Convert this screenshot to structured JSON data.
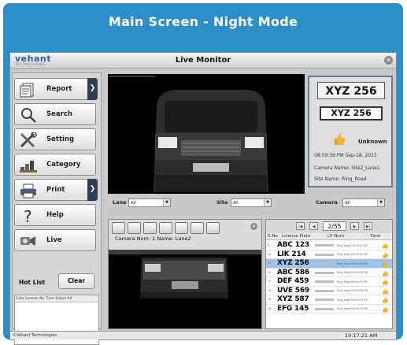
{
  "banner": {
    "title": "Main Screen - Night Mode"
  },
  "window": {
    "logo": "vehant",
    "logo_sub": "TECHNOLOGIES",
    "title": "Live Monitor",
    "close_icon": "close-icon"
  },
  "sidebar": {
    "items": [
      {
        "label": "Report",
        "icon": "report-icon",
        "has_dropdown": true
      },
      {
        "label": "Search",
        "icon": "search-icon",
        "has_dropdown": false
      },
      {
        "label": "Setting",
        "icon": "tools-icon",
        "has_dropdown": false
      },
      {
        "label": "Category",
        "icon": "category-icon",
        "has_dropdown": false
      },
      {
        "label": "Print",
        "icon": "printer-icon",
        "has_dropdown": true
      },
      {
        "label": "Help",
        "icon": "help-icon",
        "has_dropdown": false
      },
      {
        "label": "Live",
        "icon": "live-camera-icon",
        "has_dropdown": false
      }
    ],
    "hotlist_label": "Hot List",
    "clear_label": "Clear",
    "hotlist_columns": "S.No  License No  Time  Select All"
  },
  "detection": {
    "plate_large": "XYZ 256",
    "plate_read": "XYZ 256",
    "status": "Unknown",
    "timestamp": "08:59:39 PM Sep-18, 2013",
    "camera_name": "Camera Name: Site2_Lane1",
    "site_name": "Site Name: Ring_Road"
  },
  "filters": {
    "lane_label": "Lane",
    "lane_value": "All",
    "site_label": "Site",
    "site_value": "All",
    "camera_label": "Camera",
    "camera_value": "All"
  },
  "lane_panel": {
    "camera_info": "Camera Num: 1 Name: Lane2"
  },
  "results": {
    "page": "2/55",
    "columns": {
      "sno": "S.No",
      "plate": "License Plate",
      "lp": "LP Num",
      "time": "Time"
    },
    "rows": [
      {
        "sno": "8",
        "plate": "ABC 123",
        "time": "Ring_Road  08:59:42 PM",
        "selected": false
      },
      {
        "sno": "10",
        "plate": "LIK 214",
        "time": "Ring_Road  08:59:40 PM",
        "selected": false
      },
      {
        "sno": "11",
        "plate": "XYZ 256",
        "time": "Ring_Road  08:59:39 PM",
        "selected": true
      },
      {
        "sno": "12",
        "plate": "ABC 586",
        "time": "Ring_Road  08:59:38 PM",
        "selected": false
      },
      {
        "sno": "13",
        "plate": "DEF 459",
        "time": "Ring_Road  08:59:37 PM",
        "selected": false
      },
      {
        "sno": "14",
        "plate": "UVE 569",
        "time": "Ring_Road  08:59:36 PM",
        "selected": false
      },
      {
        "sno": "15",
        "plate": "XYZ 587",
        "time": "Ring_Road  08:59:35 PM",
        "selected": false
      },
      {
        "sno": "16",
        "plate": "EFG 145",
        "time": "Ring_Road  08:59:34 PM",
        "selected": false
      }
    ]
  },
  "status_bar": {
    "copyright": "©Vehant Technologies",
    "clock": "10:17:21 AM"
  },
  "colors": {
    "banner": "#2c8fc8",
    "dropdown_segment": "#2f3d55",
    "selected_row": "#9fc3e8",
    "thumb": "#f0b429"
  }
}
